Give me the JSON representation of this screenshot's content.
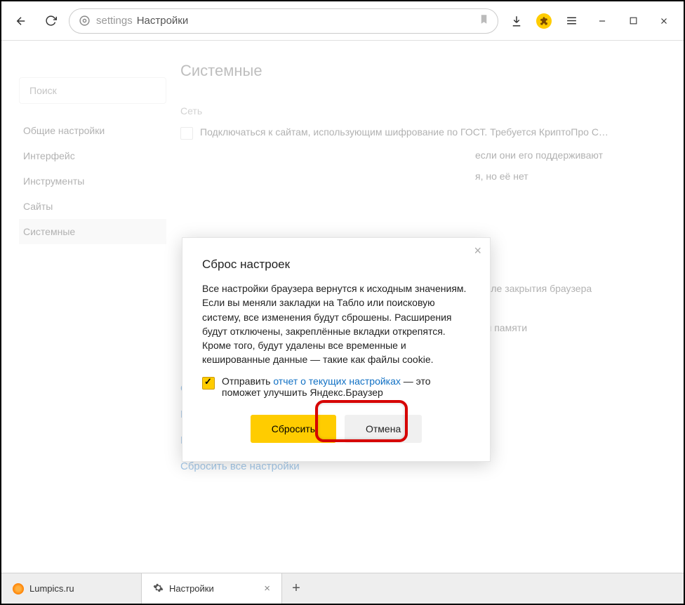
{
  "toolbar": {
    "address_prefix": "settings",
    "address_text": "Настройки"
  },
  "sidebar": {
    "search_placeholder": "Поиск",
    "items": [
      {
        "label": "Общие настройки"
      },
      {
        "label": "Интерфейс"
      },
      {
        "label": "Инструменты"
      },
      {
        "label": "Сайты"
      },
      {
        "label": "Системные"
      }
    ],
    "active_index": 4
  },
  "main": {
    "page_title": "Системные",
    "section_network": "Сеть",
    "row1": "Подключаться к сайтам, использующим шифрование по ГОСТ. Требуется КриптоПро C…",
    "row2_fragment": "если они его поддерживают",
    "row3_fragment": "я, но её нет",
    "row4_fragment": "после закрытия браузера",
    "row5_fragment": "ной памяти",
    "links": [
      "Очистить историю",
      "Настройки языка и региона",
      "Настройки персональных данных",
      "Сбросить все настройки"
    ]
  },
  "modal": {
    "title": "Сброс настроек",
    "body": "Все настройки браузера вернутся к исходным значениям. Если вы меняли закладки на Табло или поисковую систему, все изменения будут сброшены. Расширения будут отключены, закреплённые вкладки открепятся. Кроме того, будут удалены все временные и кешированные данные — такие как файлы cookie.",
    "checkbox_pre": "Отправить ",
    "checkbox_link": "отчет о текущих настройках",
    "checkbox_post": " — это поможет улучшить Яндекс.Браузер",
    "btn_primary": "Сбросить",
    "btn_cancel": "Отмена"
  },
  "tabs": {
    "items": [
      {
        "label": "Lumpics.ru"
      },
      {
        "label": "Настройки"
      }
    ],
    "active_index": 1
  }
}
